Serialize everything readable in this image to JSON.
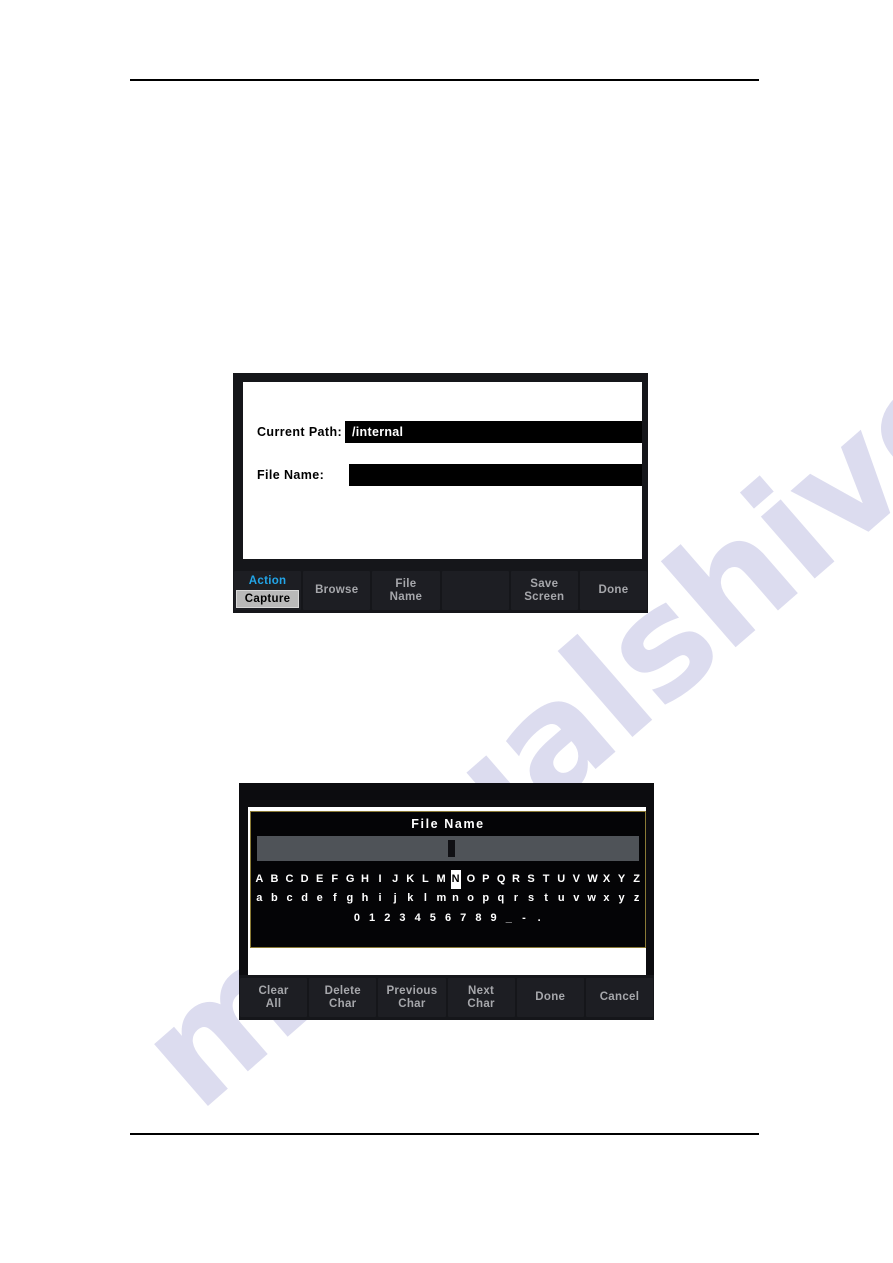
{
  "page": {
    "watermark": "manualshive.com",
    "watermark_color": "#2b2b9e",
    "header_rule": "",
    "footer_rule": ""
  },
  "figure_one": {
    "name": "save-screen-dialog",
    "fields": [
      {
        "label": "Current Path:",
        "value": "/internal"
      },
      {
        "label": "File Name:",
        "value": ""
      }
    ],
    "softkeys": [
      {
        "type": "two-tier",
        "title": "Action",
        "chip": "Capture",
        "title_color": "#22a5e8",
        "chip_bg": "#b9b9b9"
      },
      {
        "type": "plain",
        "line1": "Browse",
        "line2": ""
      },
      {
        "type": "plain",
        "line1": "File",
        "line2": "Name"
      },
      {
        "type": "blank",
        "line1": "",
        "line2": ""
      },
      {
        "type": "plain",
        "line1": "Save",
        "line2": "Screen"
      },
      {
        "type": "plain",
        "line1": "Done",
        "line2": ""
      }
    ]
  },
  "figure_two": {
    "name": "file-name-keypad-dialog",
    "title": "File Name",
    "input_value": "",
    "caret": "|",
    "selected_char": "N",
    "rows": {
      "uppercase": [
        "A",
        "B",
        "C",
        "D",
        "E",
        "F",
        "G",
        "H",
        "I",
        "J",
        "K",
        "L",
        "M",
        "N",
        "O",
        "P",
        "Q",
        "R",
        "S",
        "T",
        "U",
        "V",
        "W",
        "X",
        "Y",
        "Z"
      ],
      "lowercase": [
        "a",
        "b",
        "c",
        "d",
        "e",
        "f",
        "g",
        "h",
        "i",
        "j",
        "k",
        "l",
        "m",
        "n",
        "o",
        "p",
        "q",
        "r",
        "s",
        "t",
        "u",
        "v",
        "w",
        "x",
        "y",
        "z"
      ],
      "digits": [
        "0",
        "1",
        "2",
        "3",
        "4",
        "5",
        "6",
        "7",
        "8",
        "9",
        "_",
        "-",
        "."
      ]
    },
    "softkeys": [
      {
        "type": "plain",
        "line1": "Clear",
        "line2": "All"
      },
      {
        "type": "plain",
        "line1": "Delete",
        "line2": "Char"
      },
      {
        "type": "plain",
        "line1": "Previous",
        "line2": "Char"
      },
      {
        "type": "plain",
        "line1": "Next",
        "line2": "Char"
      },
      {
        "type": "plain",
        "line1": "Done",
        "line2": ""
      },
      {
        "type": "plain",
        "line1": "Cancel",
        "line2": ""
      }
    ]
  }
}
